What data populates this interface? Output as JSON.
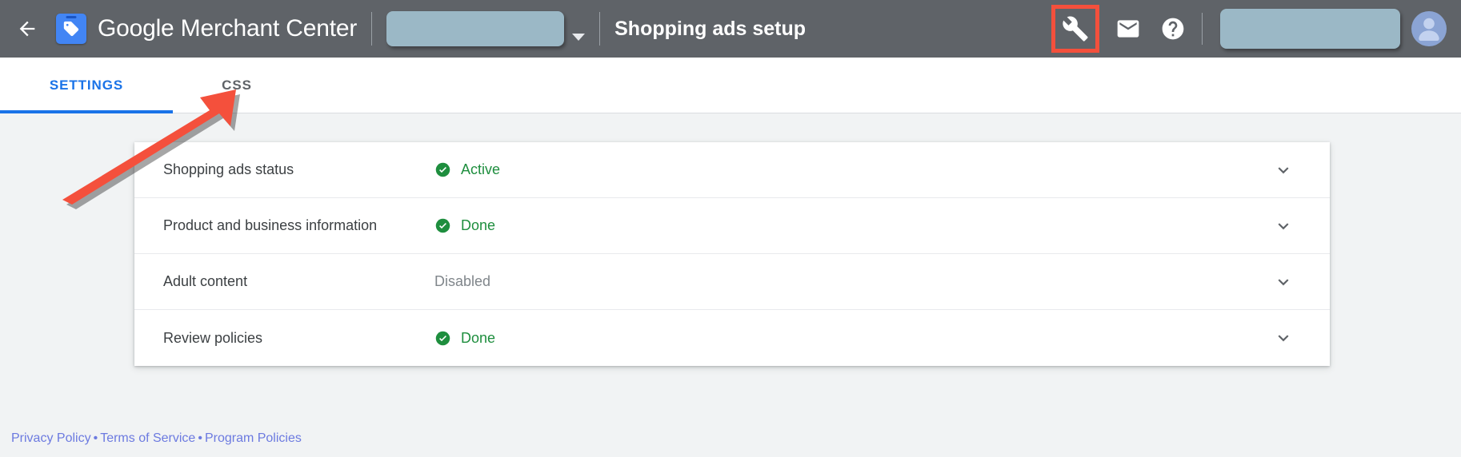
{
  "header": {
    "back_icon": "arrow-left-icon",
    "logo_icon": "merchant-center-tag-icon",
    "brand_google": "Google",
    "brand_suffix": " Merchant Center",
    "account_selector_value": "",
    "caret_icon": "chevron-down-icon",
    "page_title": "Shopping ads setup",
    "wrench_icon": "wrench-icon",
    "mail_icon": "mail-icon",
    "help_icon": "help-icon",
    "user_field_value": "",
    "avatar_icon": "avatar-icon",
    "highlight_color": "#f4503c",
    "bar_color": "#5f6368",
    "redaction_color": "#9bb8c6"
  },
  "tabs": [
    {
      "label": "SETTINGS",
      "active": true
    },
    {
      "label": "CSS",
      "active": false
    }
  ],
  "setup_rows": [
    {
      "label": "Shopping ads status",
      "status": "Active",
      "status_type": "ok",
      "expand_icon": "chevron-down-icon"
    },
    {
      "label": "Product and business information",
      "status": "Done",
      "status_type": "ok",
      "expand_icon": "chevron-down-icon"
    },
    {
      "label": "Adult content",
      "status": "Disabled",
      "status_type": "muted",
      "expand_icon": "chevron-down-icon"
    },
    {
      "label": "Review policies",
      "status": "Done",
      "status_type": "ok",
      "expand_icon": "chevron-down-icon"
    }
  ],
  "footer": {
    "privacy": "Privacy Policy",
    "sep1": "•",
    "terms": "Terms of Service",
    "sep2": "•",
    "program": "Program Policies",
    "link_color": "#6c7ae0"
  },
  "annotations": {
    "arrow_color": "#f4503c",
    "arrow_target": "css-tab",
    "highlight_target": "wrench-icon"
  },
  "colors": {
    "status_ok": "#1e8e3e",
    "status_muted": "#80868b",
    "tab_active": "#1a73e8",
    "page_bg": "#f1f3f4"
  }
}
